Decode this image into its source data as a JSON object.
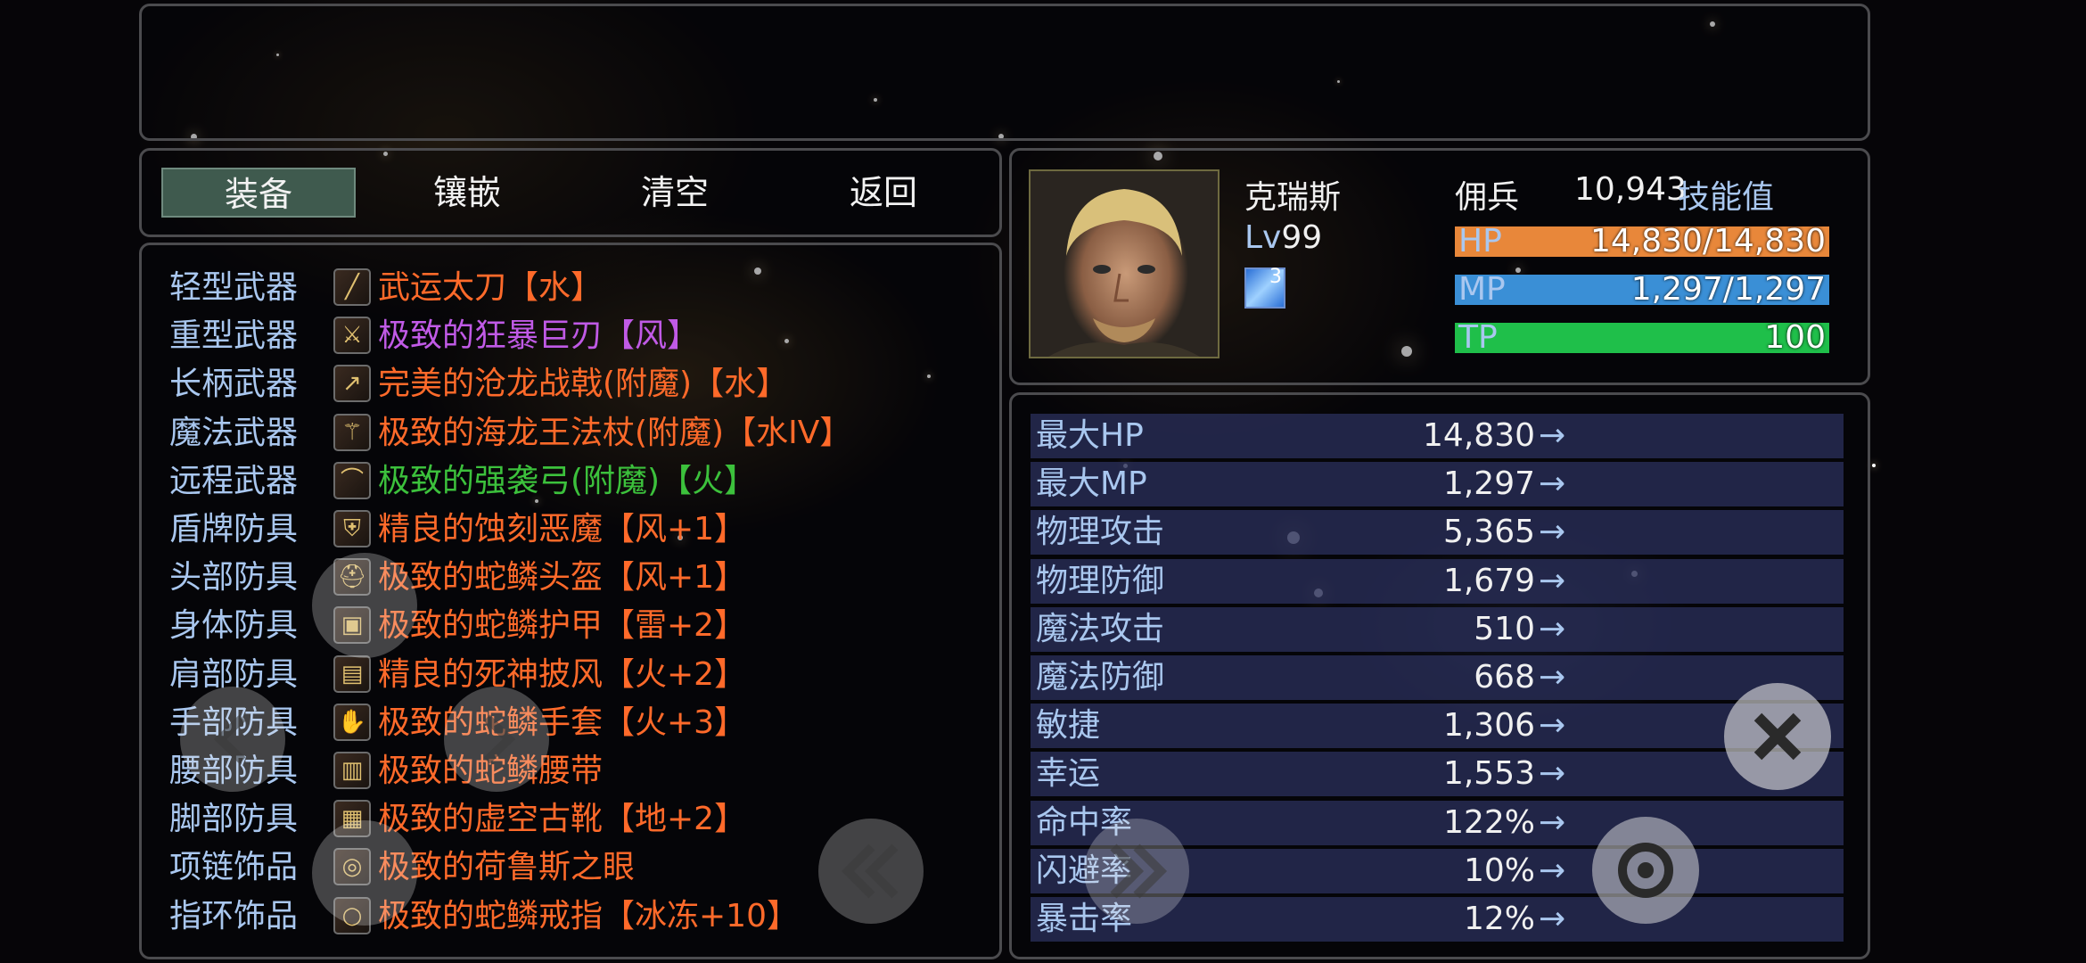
{
  "tabs": [
    {
      "label": "装备"
    },
    {
      "label": "镶嵌"
    },
    {
      "label": "清空"
    },
    {
      "label": "返回"
    }
  ],
  "equipment": [
    {
      "category": "轻型武器",
      "item": "武运太刀【水】",
      "color": "#ff6a2a",
      "icon": "katana-icon"
    },
    {
      "category": "重型武器",
      "item": "极致的狂暴巨刃【风】",
      "color": "#c05ae6",
      "icon": "greatsword-icon"
    },
    {
      "category": "长柄武器",
      "item": "完美的沧龙战戟(附魔)【水】",
      "color": "#ff6a2a",
      "icon": "halberd-icon"
    },
    {
      "category": "魔法武器",
      "item": "极致的海龙王法杖(附魔)【水IV】",
      "color": "#ff6a2a",
      "icon": "staff-icon"
    },
    {
      "category": "远程武器",
      "item": "极致的强袭弓(附魔)【火】",
      "color": "#3cc13c",
      "icon": "bow-icon"
    },
    {
      "category": "盾牌防具",
      "item": "精良的蚀刻恶魔【风+1】",
      "color": "#ff6a2a",
      "icon": "shield-icon"
    },
    {
      "category": "头部防具",
      "item": "极致的蛇鳞头盔【风+1】",
      "color": "#ff6a2a",
      "icon": "helmet-icon"
    },
    {
      "category": "身体防具",
      "item": "极致的蛇鳞护甲【雷+2】",
      "color": "#ff6a2a",
      "icon": "armor-icon"
    },
    {
      "category": "肩部防具",
      "item": "精良的死神披风【火+2】",
      "color": "#ff6a2a",
      "icon": "cloak-icon"
    },
    {
      "category": "手部防具",
      "item": "极致的蛇鳞手套【火+3】",
      "color": "#ff6a2a",
      "icon": "gloves-icon"
    },
    {
      "category": "腰部防具",
      "item": "极致的蛇鳞腰带",
      "color": "#ff6a2a",
      "icon": "belt-icon"
    },
    {
      "category": "脚部防具",
      "item": "极致的虚空古靴【地+2】",
      "color": "#ff6a2a",
      "icon": "boots-icon"
    },
    {
      "category": "项链饰品",
      "item": "极致的荷鲁斯之眼",
      "color": "#ff6a2a",
      "icon": "necklace-icon"
    },
    {
      "category": "指环饰品",
      "item": "极致的蛇鳞戒指【冰冻+10】",
      "color": "#ff6a2a",
      "icon": "ring-icon"
    }
  ],
  "character": {
    "name": "克瑞斯",
    "class": "佣兵",
    "skill_points_value": "10,943",
    "skill_points_label": "技能值",
    "level_prefix": "Lv",
    "level": "99",
    "skill_badge": "3",
    "hp_label": "HP",
    "hp_text": "14,830/14,830",
    "hp_fraction": 1.0,
    "mp_label": "MP",
    "mp_text": "1,297/1,297",
    "mp_fraction": 1.0,
    "tp_label": "TP",
    "tp_text": "100",
    "tp_fraction": 1.0
  },
  "stats": [
    {
      "label": "最大HP",
      "value": "14,830",
      "arrow": "→"
    },
    {
      "label": "最大MP",
      "value": "1,297",
      "arrow": "→"
    },
    {
      "label": "物理攻击",
      "value": "5,365",
      "arrow": "→"
    },
    {
      "label": "物理防御",
      "value": "1,679",
      "arrow": "→"
    },
    {
      "label": "魔法攻击",
      "value": "510",
      "arrow": "→"
    },
    {
      "label": "魔法防御",
      "value": "668",
      "arrow": "→"
    },
    {
      "label": "敏捷",
      "value": "1,306",
      "arrow": "→"
    },
    {
      "label": "幸运",
      "value": "1,553",
      "arrow": "→"
    },
    {
      "label": "命中率",
      "value": "122%",
      "arrow": "→"
    },
    {
      "label": "闪避率",
      "value": "10%",
      "arrow": "→"
    },
    {
      "label": "暴击率",
      "value": "12%",
      "arrow": "→"
    }
  ],
  "colors": {
    "hp_bar": "#e8873a",
    "mp_bar": "#3a8fd6",
    "tp_bar": "#1fbf4a",
    "label_blue": "#a9c7ef"
  }
}
